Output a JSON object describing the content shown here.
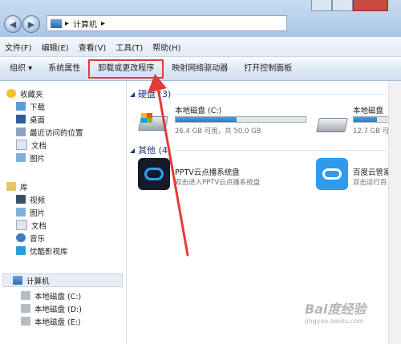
{
  "address": {
    "separator": "▸",
    "path": "计算机",
    "dropdown": "▸"
  },
  "menubar": [
    {
      "label": "文件(F)"
    },
    {
      "label": "编辑(E)"
    },
    {
      "label": "查看(V)"
    },
    {
      "label": "工具(T)"
    },
    {
      "label": "帮助(H)"
    }
  ],
  "toolbar": {
    "organize": "组织 ▾",
    "system_props": "系统属性",
    "uninstall": "卸载或更改程序",
    "map_drive": "映射网络驱动器",
    "control_panel": "打开控制面板"
  },
  "sidebar": {
    "favorites": "收藏夹",
    "downloads": "下载",
    "desktop": "桌面",
    "recent": "最近访问的位置",
    "documents": "文档",
    "pictures": "图片",
    "libraries": "库",
    "videos": "视频",
    "lib_pictures": "图片",
    "lib_documents": "文档",
    "music": "音乐",
    "youku": "优酷影视库",
    "computer": "计算机",
    "disk_c": "本地磁盘 (C:)",
    "disk_d": "本地磁盘 (D:)",
    "disk_e": "本地磁盘 (E:)"
  },
  "content": {
    "hdd_group": "硬盘 (3)",
    "other_group": "其他 (4)",
    "drive_c": {
      "name": "本地磁盘 (C:)",
      "info": "26.4 GB 可用，共 50.0 GB",
      "used_fraction": 0.47
    },
    "drive_d": {
      "name": "本地磁盘",
      "info": "12.7 GB 可",
      "used_fraction": 0.5
    },
    "pptv": {
      "name": "PPTV云点播系统盘",
      "desc": "双击进入PPTV云点播系统盘"
    },
    "baidu": {
      "name": "百度云管家",
      "desc": "双击运行百"
    }
  },
  "watermark": {
    "text": "Bai度经验",
    "url": "jingyan.baidu.com"
  },
  "colors": {
    "accent": "#e33a3a",
    "link": "#1e3287",
    "bar": "#1e7fc1"
  }
}
